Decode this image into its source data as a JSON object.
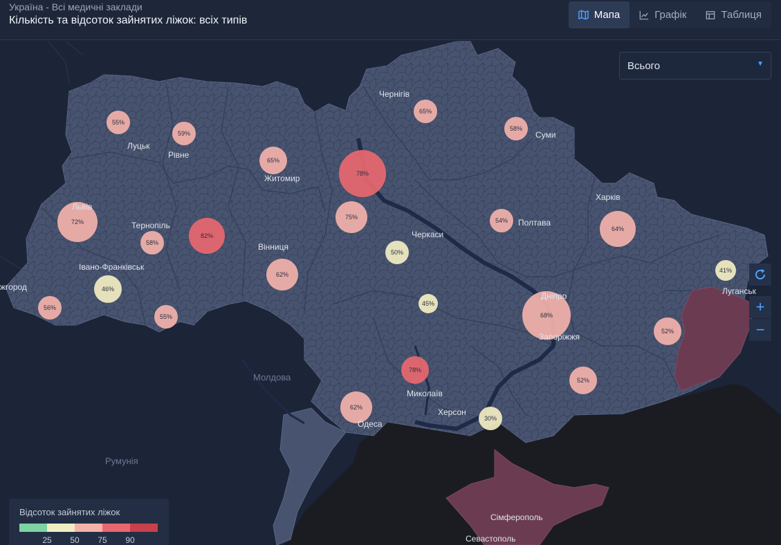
{
  "header": {
    "subtitle": "Україна - Всі медичні заклади",
    "title": "Кількість та відсоток зайнятих ліжок: всіх типів"
  },
  "tabs": [
    {
      "label": "Мапа",
      "icon": "map-icon",
      "active": true
    },
    {
      "label": "Графік",
      "icon": "chart-line-icon",
      "active": false
    },
    {
      "label": "Таблиця",
      "icon": "table-icon",
      "active": false
    }
  ],
  "filter": {
    "selected": "Всього"
  },
  "controls": {
    "refresh": "refresh-icon",
    "zoom_in": "+",
    "zoom_out": "−"
  },
  "legend": {
    "title": "Відсоток зайнятих ліжок",
    "ticks": [
      "25",
      "50",
      "75",
      "90"
    ],
    "colors": [
      "#7fd3a3",
      "#f2eec2",
      "#f4b2aa",
      "#e9686f",
      "#c9404c"
    ]
  },
  "map": {
    "colors": {
      "land": "#48536f",
      "occupied": "#6b3b52",
      "neighbor": "#1c2438",
      "sea": "#1b1c22",
      "water": "#1d2a48"
    },
    "outside_labels": [
      "Молдова",
      "Румунія"
    ],
    "cities": [
      {
        "name": "Луцьк"
      },
      {
        "name": "Рівне"
      },
      {
        "name": "Житомир"
      },
      {
        "name": "Чернігів"
      },
      {
        "name": "Суми"
      },
      {
        "name": "Харків"
      },
      {
        "name": "Полтава"
      },
      {
        "name": "Черкаси"
      },
      {
        "name": "Тернопіль"
      },
      {
        "name": "Львів"
      },
      {
        "name": "Вінниця"
      },
      {
        "name": "Івано-Франківськ"
      },
      {
        "name": "жгород"
      },
      {
        "name": "Дніпро"
      },
      {
        "name": "Запоріжжя"
      },
      {
        "name": "Луганськ"
      },
      {
        "name": "Миколаїв"
      },
      {
        "name": "Херсон"
      },
      {
        "name": "Одеса"
      },
      {
        "name": "Сімферополь"
      },
      {
        "name": "Севастополь"
      }
    ],
    "bubbles": [
      {
        "label": "55%",
        "value": 55,
        "color": "#f4b2aa"
      },
      {
        "label": "59%",
        "value": 59,
        "color": "#f4b2aa"
      },
      {
        "label": "65%",
        "value": 65,
        "color": "#f4b2aa"
      },
      {
        "label": "78%",
        "value": 78,
        "color": "#e9686f"
      },
      {
        "label": "65%",
        "value": 65,
        "color": "#f4b2aa"
      },
      {
        "label": "58%",
        "value": 58,
        "color": "#f4b2aa"
      },
      {
        "label": "72%",
        "value": 72,
        "color": "#f4b2aa"
      },
      {
        "label": "58%",
        "value": 58,
        "color": "#f4b2aa"
      },
      {
        "label": "82%",
        "value": 82,
        "color": "#e9686f"
      },
      {
        "label": "75%",
        "value": 75,
        "color": "#f4b2aa"
      },
      {
        "label": "54%",
        "value": 54,
        "color": "#f4b2aa"
      },
      {
        "label": "64%",
        "value": 64,
        "color": "#f4b2aa"
      },
      {
        "label": "50%",
        "value": 50,
        "color": "#f2eec2"
      },
      {
        "label": "46%",
        "value": 46,
        "color": "#f2eec2"
      },
      {
        "label": "62%",
        "value": 62,
        "color": "#f4b2aa"
      },
      {
        "label": "41%",
        "value": 41,
        "color": "#f2eec2"
      },
      {
        "label": "56%",
        "value": 56,
        "color": "#f4b2aa"
      },
      {
        "label": "45%",
        "value": 45,
        "color": "#f2eec2"
      },
      {
        "label": "55%",
        "value": 55,
        "color": "#f4b2aa"
      },
      {
        "label": "68%",
        "value": 68,
        "color": "#f4b2aa"
      },
      {
        "label": "52%",
        "value": 52,
        "color": "#f4b2aa"
      },
      {
        "label": "78%",
        "value": 78,
        "color": "#e9686f"
      },
      {
        "label": "52%",
        "value": 52,
        "color": "#f4b2aa"
      },
      {
        "label": "62%",
        "value": 62,
        "color": "#f4b2aa"
      },
      {
        "label": "30%",
        "value": 30,
        "color": "#f2eec2"
      }
    ]
  }
}
